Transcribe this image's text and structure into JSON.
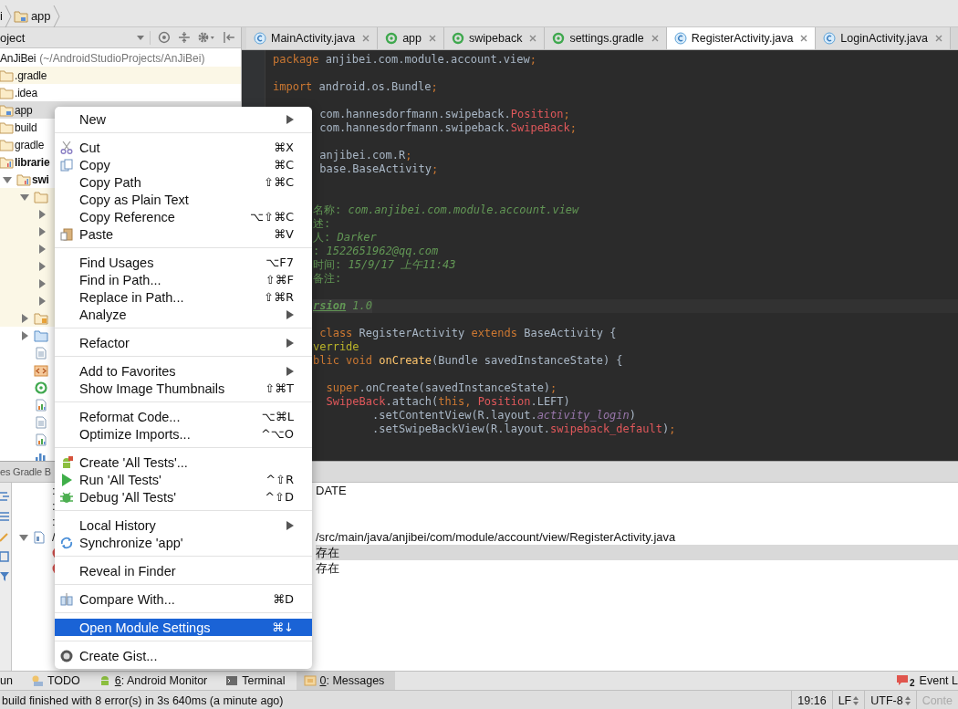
{
  "breadcrumb": [
    {
      "label": "i",
      "kind": "plain"
    },
    {
      "label": "app",
      "kind": "module"
    }
  ],
  "project_panel": {
    "view": "oject",
    "tree": [
      {
        "label": "AnJiBei",
        "note": "(~/AndroidStudioProjects/AnJiBei)",
        "selected": false,
        "highlighted": false,
        "children": [
          {
            "label": ".gradle",
            "kind": "folder",
            "selected": false,
            "highlighted": true
          },
          {
            "label": ".idea",
            "kind": "folder",
            "selected": false,
            "highlighted": false
          },
          {
            "label": "app",
            "kind": "module",
            "selected": true,
            "highlighted": false
          },
          {
            "label": "build",
            "kind": "folder",
            "selected": false,
            "highlighted": false
          },
          {
            "label": "gradle",
            "kind": "folder",
            "selected": false,
            "highlighted": false
          },
          {
            "label": "librarie",
            "kind": "lib-module",
            "selected": false,
            "highlighted": false,
            "children": [
              {
                "label": "swi",
                "kind": "lib-module",
                "expanded": true,
                "selected": false,
                "highlighted": false,
                "children": [
                  {
                    "kind": "folder",
                    "expanded": true,
                    "selected": false,
                    "highlighted": true,
                    "children": [
                      {
                        "expanded": false,
                        "selected": false,
                        "highlighted": true
                      },
                      {
                        "expanded": false,
                        "selected": false,
                        "highlighted": true
                      },
                      {
                        "expanded": false,
                        "selected": false,
                        "highlighted": true
                      },
                      {
                        "expanded": false,
                        "selected": false,
                        "highlighted": true
                      },
                      {
                        "expanded": false,
                        "selected": false,
                        "highlighted": true
                      },
                      {
                        "expanded": false,
                        "selected": false,
                        "highlighted": true
                      }
                    ]
                  },
                  {
                    "kind": "res-folder",
                    "expanded": false,
                    "selected": false,
                    "highlighted": true
                  },
                  {
                    "kind": "src-folder",
                    "expanded": false,
                    "selected": false,
                    "highlighted": false
                  },
                  {
                    "kind": "file",
                    "selected": false,
                    "highlighted": false
                  },
                  {
                    "kind": "xml",
                    "selected": false,
                    "highlighted": false
                  },
                  {
                    "kind": "gradle",
                    "selected": false,
                    "highlighted": false
                  },
                  {
                    "kind": "chart",
                    "selected": false,
                    "highlighted": false
                  },
                  {
                    "kind": "file",
                    "selected": false,
                    "highlighted": false
                  },
                  {
                    "kind": "chart",
                    "selected": false,
                    "highlighted": false
                  },
                  {
                    "kind": "props",
                    "selected": false,
                    "highlighted": false
                  }
                ]
              }
            ]
          }
        ]
      }
    ]
  },
  "tabs": [
    {
      "label": "MainActivity.java",
      "kind": "class",
      "selected": false
    },
    {
      "label": "app",
      "kind": "gradle",
      "selected": false
    },
    {
      "label": "swipeback",
      "kind": "gradle",
      "selected": false
    },
    {
      "label": "settings.gradle",
      "kind": "gradle",
      "selected": false
    },
    {
      "label": "RegisterActivity.java",
      "kind": "class",
      "selected": true
    },
    {
      "label": "LoginActivity.java",
      "kind": "class",
      "selected": false
    }
  ],
  "editor": {
    "lines": [
      {
        "kind": "full",
        "current": false,
        "segs": [
          {
            "t": "package",
            "kind": "kw"
          },
          {
            "t": " anjibei.com.module.account.view",
            "kind": "plain"
          },
          {
            "t": ";",
            "kind": "kw"
          }
        ]
      },
      {
        "kind": "blank"
      },
      {
        "kind": "full",
        "current": false,
        "segs": [
          {
            "t": "import",
            "kind": "kw"
          },
          {
            "t": " android.os.Bundle",
            "kind": "plain"
          },
          {
            "t": ";",
            "kind": "kw"
          }
        ]
      },
      {
        "kind": "blank"
      },
      {
        "kind": "partial",
        "current": false,
        "segs": [
          {
            "t": " com.hannesdorfmann.swipeback.",
            "kind": "plain"
          },
          {
            "t": "Position",
            "kind": "red"
          },
          {
            "t": ";",
            "kind": "kw"
          }
        ]
      },
      {
        "kind": "partial",
        "current": false,
        "segs": [
          {
            "t": " com.hannesdorfmann.swipeback.",
            "kind": "plain"
          },
          {
            "t": "SwipeBack",
            "kind": "red"
          },
          {
            "t": ";",
            "kind": "kw"
          }
        ]
      },
      {
        "kind": "blank"
      },
      {
        "kind": "partial",
        "current": false,
        "segs": [
          {
            "t": " anjibei.com.R",
            "kind": "plain"
          },
          {
            "t": ";",
            "kind": "kw"
          }
        ]
      },
      {
        "kind": "partial",
        "current": false,
        "segs": [
          {
            "t": " base.BaseActivity",
            "kind": "plain"
          },
          {
            "t": ";",
            "kind": "kw"
          }
        ]
      },
      {
        "kind": "blank"
      },
      {
        "kind": "blank"
      },
      {
        "kind": "partial",
        "current": false,
        "segs": [
          {
            "t": "名称: ",
            "kind": "doc"
          },
          {
            "t": "com.anjibei.com.module.account.view",
            "kind": "doci"
          }
        ]
      },
      {
        "kind": "partial",
        "current": false,
        "segs": [
          {
            "t": "述:",
            "kind": "doc"
          }
        ]
      },
      {
        "kind": "partial",
        "current": false,
        "segs": [
          {
            "t": "人: ",
            "kind": "doc"
          },
          {
            "t": "Darker",
            "kind": "doci"
          }
        ]
      },
      {
        "kind": "partial",
        "current": false,
        "segs": [
          {
            "t": ": ",
            "kind": "doc"
          },
          {
            "t": "1522651962@qq.com",
            "kind": "doci"
          }
        ]
      },
      {
        "kind": "partial",
        "current": false,
        "segs": [
          {
            "t": "时间: ",
            "kind": "doc"
          },
          {
            "t": "15/9/17 上午11:43",
            "kind": "doci"
          }
        ]
      },
      {
        "kind": "partial",
        "current": false,
        "segs": [
          {
            "t": "备注:",
            "kind": "doc"
          }
        ]
      },
      {
        "kind": "blank"
      },
      {
        "kind": "partial",
        "current": true,
        "segs": [
          {
            "t": "rsion",
            "kind": "tag"
          },
          {
            "t": " 1.0",
            "kind": "doci"
          }
        ]
      },
      {
        "kind": "blank"
      },
      {
        "kind": "partial",
        "current": false,
        "segs": [
          {
            "t": " class",
            "kind": "kw"
          },
          {
            "t": " RegisterActivity ",
            "kind": "plain"
          },
          {
            "t": "extends",
            "kind": "kw"
          },
          {
            "t": " BaseActivity {",
            "kind": "plain"
          }
        ]
      },
      {
        "kind": "partial",
        "current": false,
        "segs": [
          {
            "t": "verride",
            "kind": "ann"
          }
        ]
      },
      {
        "kind": "partial",
        "current": false,
        "segs": [
          {
            "t": "blic void ",
            "kind": "kw"
          },
          {
            "t": "onCreate",
            "kind": "fn"
          },
          {
            "t": "(Bundle savedInstanceState) {",
            "kind": "plain"
          }
        ]
      },
      {
        "kind": "blank"
      },
      {
        "kind": "partial",
        "current": false,
        "segs": [
          {
            "t": "  super",
            "kind": "kw"
          },
          {
            "t": ".onCreate(savedInstanceState)",
            "kind": "plain"
          },
          {
            "t": ";",
            "kind": "kw"
          }
        ]
      },
      {
        "kind": "partial",
        "current": false,
        "segs": [
          {
            "t": "  SwipeBack",
            "kind": "red"
          },
          {
            "t": ".attach(",
            "kind": "plain"
          },
          {
            "t": "this, ",
            "kind": "kw"
          },
          {
            "t": "Position",
            "kind": "red"
          },
          {
            "t": ".LEFT)",
            "kind": "plain"
          }
        ]
      },
      {
        "kind": "partial",
        "current": false,
        "segs": [
          {
            "t": "         .setContentView(R.layout.",
            "kind": "plain"
          },
          {
            "t": "activity_login",
            "kind": "field"
          },
          {
            "t": ")",
            "kind": "plain"
          }
        ]
      },
      {
        "kind": "partial",
        "current": false,
        "segs": [
          {
            "t": "         .setSwipeBackView(R.layout.",
            "kind": "plain"
          },
          {
            "t": "swipeback_default",
            "kind": "red"
          },
          {
            "t": ")",
            "kind": "plain"
          },
          {
            "t": ";",
            "kind": "kw"
          }
        ]
      }
    ]
  },
  "messages_panel": {
    "title": "es Gradle B",
    "rows": [
      {
        "kind": "info",
        "prefix": ":",
        "text": "DATE",
        "selected": false
      },
      {
        "kind": "info",
        "prefix": ":",
        "selected": false
      },
      {
        "kind": "info",
        "prefix": ":",
        "selected": false
      },
      {
        "kind": "file",
        "expanded": true,
        "prefix": "/",
        "text": "/src/main/java/anjibei/com/module/account/view/RegisterActivity.java",
        "selected": false
      },
      {
        "kind": "error",
        "text": "存在",
        "selected": true
      },
      {
        "kind": "error",
        "text": "存在",
        "selected": false
      }
    ]
  },
  "context_menu": {
    "groups": [
      [
        {
          "label": "New",
          "submenu": true,
          "selected": false
        }
      ],
      [
        {
          "label": "Cut",
          "kind": "cut",
          "shortcut": "⌘X",
          "selected": false
        },
        {
          "label": "Copy",
          "kind": "copy",
          "shortcut": "⌘C",
          "selected": false
        },
        {
          "label": "Copy Path",
          "shortcut": "⇧⌘C",
          "selected": false
        },
        {
          "label": "Copy as Plain Text",
          "selected": false
        },
        {
          "label": "Copy Reference",
          "shortcut": "⌥⇧⌘C",
          "selected": false
        },
        {
          "label": "Paste",
          "kind": "paste",
          "shortcut": "⌘V",
          "selected": false
        }
      ],
      [
        {
          "label": "Find Usages",
          "shortcut": "⌥F7",
          "selected": false
        },
        {
          "label": "Find in Path...",
          "shortcut": "⇧⌘F",
          "selected": false
        },
        {
          "label": "Replace in Path...",
          "shortcut": "⇧⌘R",
          "selected": false
        },
        {
          "label": "Analyze",
          "submenu": true,
          "selected": false
        }
      ],
      [
        {
          "label": "Refactor",
          "submenu": true,
          "selected": false
        }
      ],
      [
        {
          "label": "Add to Favorites",
          "submenu": true,
          "selected": false
        },
        {
          "label": "Show Image Thumbnails",
          "shortcut": "⇧⌘T",
          "selected": false
        }
      ],
      [
        {
          "label": "Reformat Code...",
          "shortcut": "⌥⌘L",
          "selected": false
        },
        {
          "label": "Optimize Imports...",
          "shortcut": "^⌥O",
          "selected": false
        }
      ],
      [
        {
          "label": "Create 'All Tests'...",
          "kind": "android",
          "selected": false
        },
        {
          "label": "Run 'All Tests'",
          "kind": "run",
          "shortcut": "^⇧R",
          "selected": false
        },
        {
          "label": "Debug 'All Tests'",
          "kind": "debug",
          "shortcut": "^⇧D",
          "selected": false
        }
      ],
      [
        {
          "label": "Local History",
          "submenu": true,
          "selected": false
        },
        {
          "label": "Synchronize 'app'",
          "kind": "sync",
          "selected": false
        }
      ],
      [
        {
          "label": "Reveal in Finder",
          "selected": false
        }
      ],
      [
        {
          "label": "Compare With...",
          "kind": "compare",
          "shortcut": "⌘D",
          "selected": false
        }
      ],
      [
        {
          "label": "Open Module Settings",
          "shortcut": "⌘↓",
          "selected": true
        }
      ],
      [
        {
          "label": "Create Gist...",
          "kind": "gist",
          "selected": false
        }
      ]
    ]
  },
  "tool_windows": [
    {
      "label": "un",
      "selected": false
    },
    {
      "label": "TODO",
      "kind": "todo",
      "selected": false
    },
    {
      "mnemonic": "6",
      "label": ": Android Monitor",
      "kind": "android",
      "selected": false
    },
    {
      "label": "Terminal",
      "kind": "terminal",
      "selected": false
    },
    {
      "mnemonic": "0",
      "label": ": Messages",
      "kind": "messages",
      "selected": true
    }
  ],
  "event_log": {
    "label": "Event L",
    "count": "2"
  },
  "status_bar": {
    "message": "build finished with 8 error(s) in 3s 640ms (a minute ago)",
    "position": "19:16",
    "line_separator": "LF",
    "encoding": "UTF-8",
    "context": "Conte"
  }
}
